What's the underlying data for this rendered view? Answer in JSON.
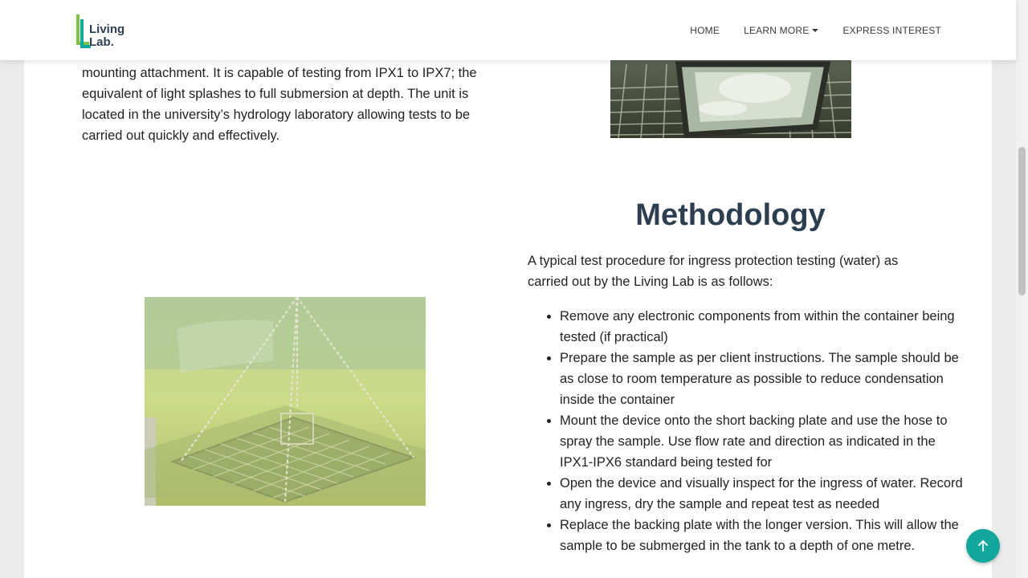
{
  "nav": {
    "logo": {
      "line1": "Living",
      "line2": "Lab."
    },
    "links": {
      "home": "HOME",
      "learn_more": "LEARN MORE",
      "express_interest": "EXPRESS INTEREST"
    }
  },
  "intro": {
    "text": "mounting attachment. It is capable of testing from IPX1 to IPX7; the equivalent of light splashes to full submersion at depth. The unit is located in the university’s hydrology laboratory allowing tests to be carried out quickly and effectively."
  },
  "methodology": {
    "title": "Methodology",
    "intro": "A typical test procedure for ingress protection testing (water) as carried out by the Living Lab is as follows:",
    "steps": [
      "Remove any electronic components from within the container being tested (if practical)",
      "Prepare the sample as per client instructions. The sample should be as close to room temperature as possible to reduce condensation inside the container",
      "Mount the device onto the short backing plate and use the hose to spray the sample. Use flow rate and direction as indicated in the IPX1-IPX6 standard being tested for",
      "Open the device and visually inspect for the ingress of water. Record any ingress, dry the sample and repeat test as needed",
      "Replace the backing plate with the longer version. This will allow the sample to be submerged in the tank to a depth of one metre."
    ]
  },
  "icons": {
    "back_to_top": "arrow-up-icon",
    "learn_more_dropdown": "caret-down-icon"
  },
  "colors": {
    "accent": "#12a79d",
    "heading": "#2d3e50",
    "logo_green": "#7dc242",
    "logo_teal": "#12a79d"
  }
}
